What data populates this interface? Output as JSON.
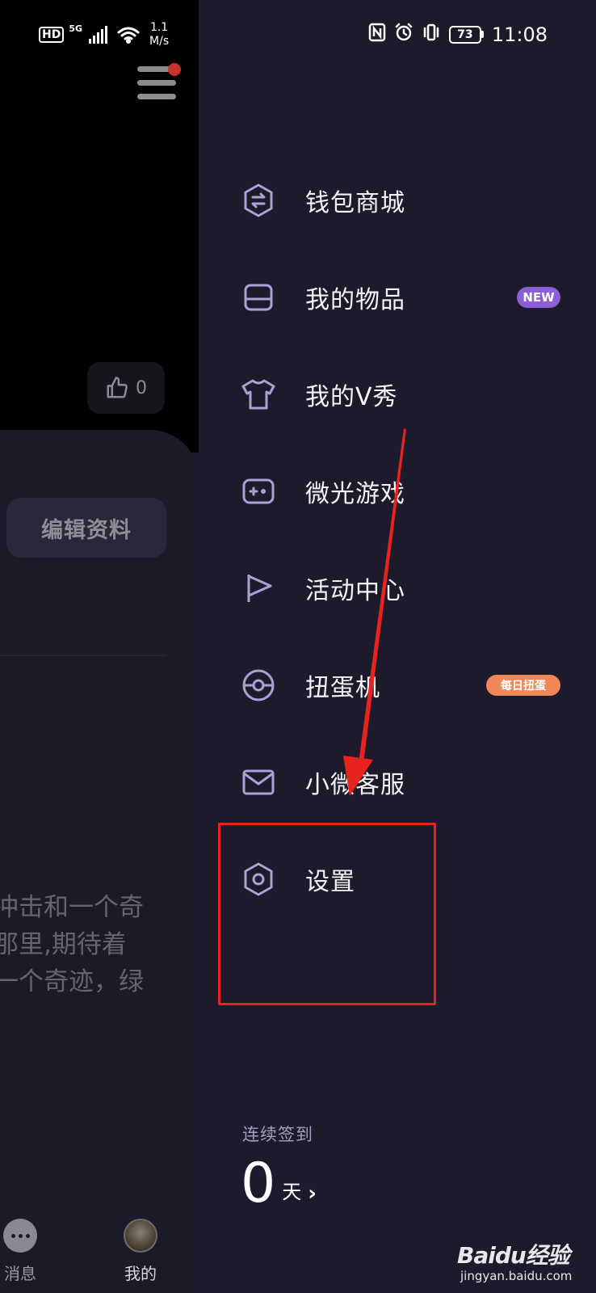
{
  "status_bar": {
    "hd": "HD",
    "network": "5G",
    "speed_value": "1.1",
    "speed_unit": "M/s",
    "battery": "73",
    "time": "11:08"
  },
  "background_page": {
    "like_count": "0",
    "edit_profile": "编辑资料",
    "bio_lines": [
      "冲击和一个奇",
      "那里,期待着",
      "一个奇迹，绿"
    ],
    "tabs": [
      {
        "label": "消息"
      },
      {
        "label": "我的"
      }
    ]
  },
  "drawer": {
    "items": [
      {
        "label": "钱包商城",
        "icon": "wallet-swap-icon"
      },
      {
        "label": "我的物品",
        "icon": "inbox-tray-icon",
        "badge": "NEW"
      },
      {
        "label": "我的V秀",
        "icon": "tshirt-icon"
      },
      {
        "label": "微光游戏",
        "icon": "gamepad-icon"
      },
      {
        "label": "活动中心",
        "icon": "flag-icon"
      },
      {
        "label": "扭蛋机",
        "icon": "gacha-ball-icon",
        "badge": "每日扭蛋"
      },
      {
        "label": "小微客服",
        "icon": "mail-icon"
      },
      {
        "label": "设置",
        "icon": "settings-hexagon-icon"
      }
    ],
    "checkin": {
      "label": "连续签到",
      "count": "0",
      "unit": "天"
    }
  },
  "watermark": {
    "brand": "Baidu经验",
    "site": "jingyan.baidu.com"
  },
  "colors": {
    "drawer_bg": "#1d1b2b",
    "icon_color": "#a7a3d6",
    "badge_new": "#8c5fd6",
    "badge_daily": "#f0885a",
    "annotation_red": "#e8231e"
  }
}
